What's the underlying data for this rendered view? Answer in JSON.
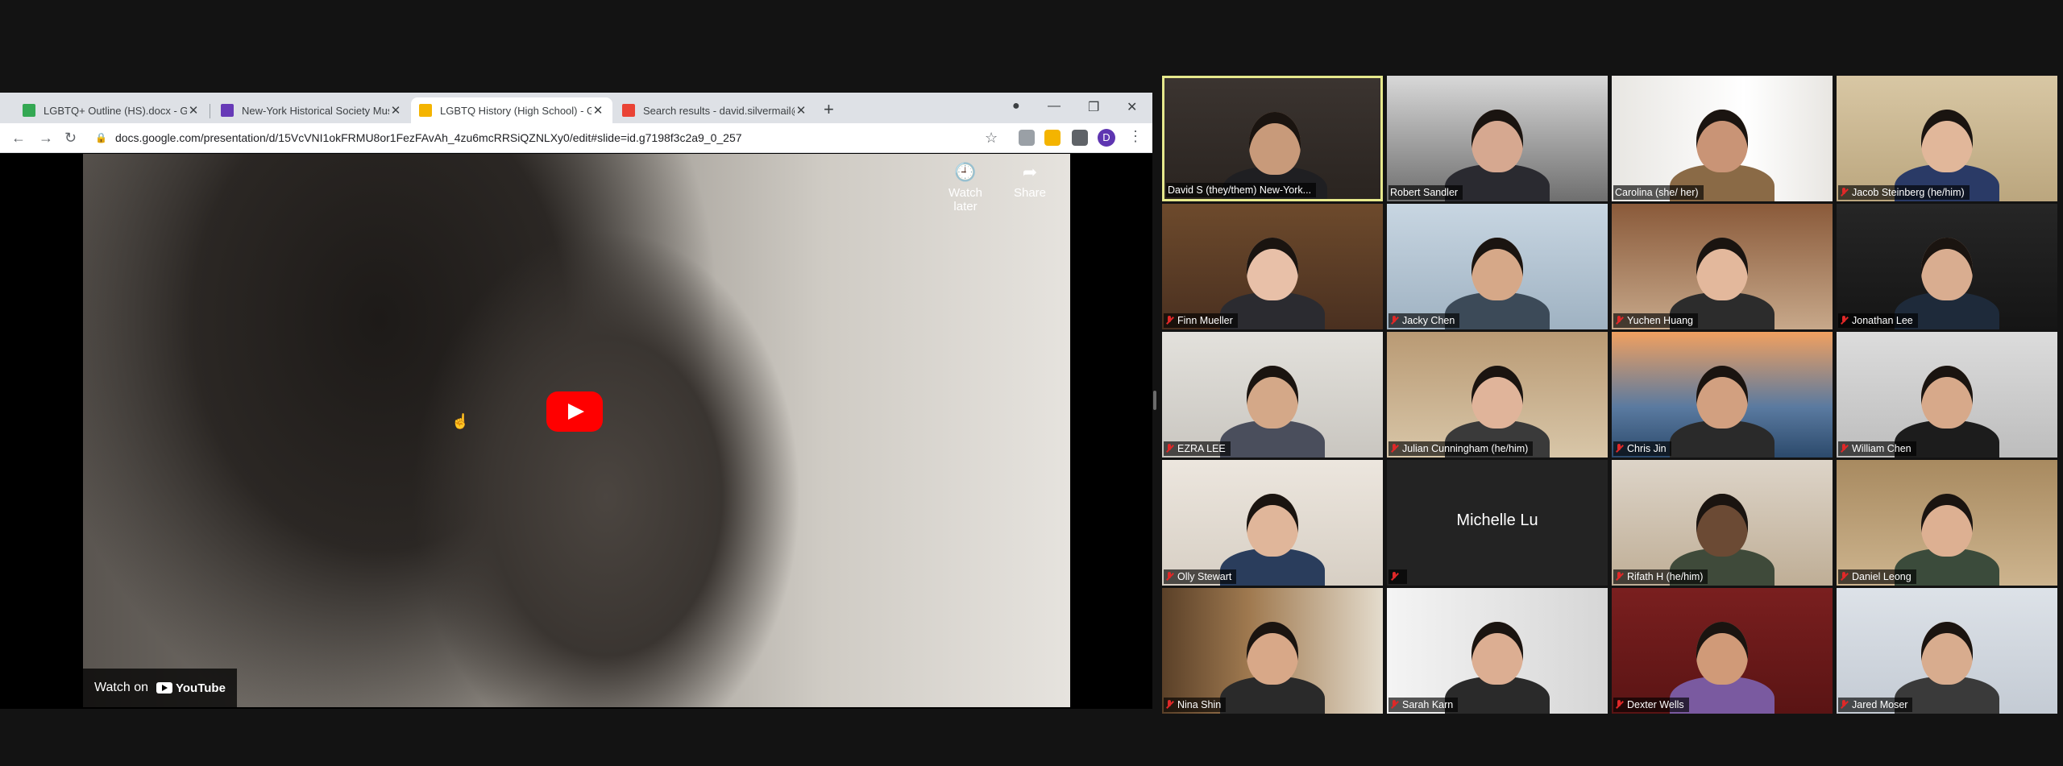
{
  "browser": {
    "tabs": [
      {
        "title": "LGBTQ+ Outline (HS).docx - Goo",
        "favicon": "drive-icon",
        "color": "#34a853",
        "active": false
      },
      {
        "title": "New-York Historical Society Mus",
        "favicon": "forms-icon",
        "color": "#673ab7",
        "active": false
      },
      {
        "title": "LGBTQ History (High School) - G",
        "favicon": "slides-icon",
        "color": "#f4b400",
        "active": true
      },
      {
        "title": "Search results - david.silvermail@",
        "favicon": "gmail-icon",
        "color": "#ea4335",
        "active": false
      }
    ],
    "new_tab": "+",
    "window_controls": {
      "minimize": "—",
      "maximize": "❐",
      "close": "✕"
    },
    "url": "docs.google.com/presentation/d/15VcVNI1okFRMU8or1FezFAvAh_4zu6mcRRSiQZNLXy0/edit#slide=id.g7198f3c2a9_0_257",
    "profile_initial": "D"
  },
  "video": {
    "watch_later": "Watch later",
    "share": "Share",
    "watch_on": "Watch on",
    "youtube": "YouTube"
  },
  "participants": [
    {
      "name": "David S (they/them) New-York...",
      "muted": false,
      "active": true
    },
    {
      "name": "Robert Sandler",
      "muted": false
    },
    {
      "name": "Carolina (she/ her)",
      "muted": false
    },
    {
      "name": "Jacob Steinberg (he/him)",
      "muted": true
    },
    {
      "name": "Finn Mueller",
      "muted": true
    },
    {
      "name": "Jacky Chen",
      "muted": true
    },
    {
      "name": "Yuchen Huang",
      "muted": true
    },
    {
      "name": "Jonathan Lee",
      "muted": true
    },
    {
      "name": "EZRA LEE",
      "muted": true
    },
    {
      "name": "Julian Cunningham (he/him)",
      "muted": true
    },
    {
      "name": "Chris Jin",
      "muted": true
    },
    {
      "name": "William Chen",
      "muted": true
    },
    {
      "name": "Olly Stewart",
      "muted": true
    },
    {
      "name": "",
      "display_name": "Michelle Lu",
      "video_off": true,
      "muted": true
    },
    {
      "name": "Rifath H (he/him)",
      "muted": true
    },
    {
      "name": "Daniel Leong",
      "muted": true
    },
    {
      "name": "Nina Shin",
      "muted": true
    },
    {
      "name": "Sarah Karn",
      "muted": true
    },
    {
      "name": "Dexter Wells",
      "muted": true
    },
    {
      "name": "Jared Moser",
      "muted": true
    }
  ]
}
